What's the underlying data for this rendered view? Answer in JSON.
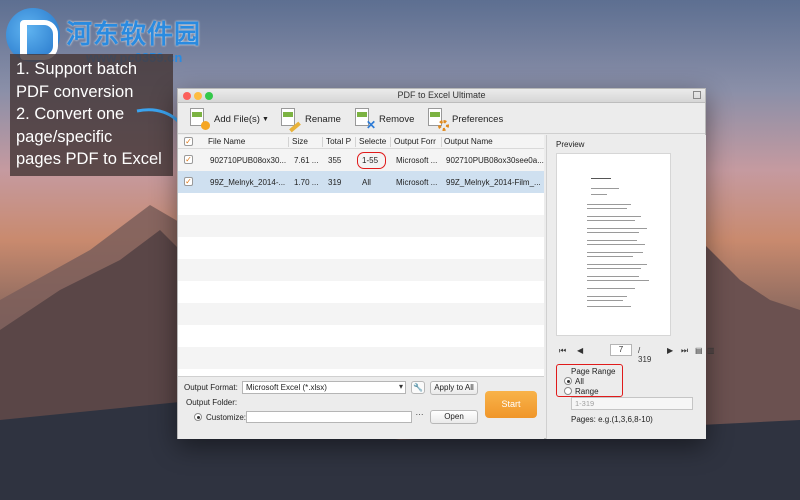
{
  "watermark": {
    "title": "河东软件园",
    "url": "www.pc0359.cn"
  },
  "annotation": {
    "lines": [
      "1. Support batch",
      "PDF conversion",
      "2. Convert one",
      "page/specific",
      "pages PDF to Excel"
    ]
  },
  "window": {
    "title": "PDF to Excel Ultimate",
    "toolbar": {
      "add_files": "Add File(s)",
      "rename": "Rename",
      "remove": "Remove",
      "preferences": "Preferences"
    },
    "columns": [
      "File Name",
      "Size",
      "Total P",
      "Selecte",
      "Output Forr",
      "Output Name"
    ],
    "rows": [
      {
        "name": "902710PUB08ox30...",
        "size": "7.61 ...",
        "total": "355",
        "selected": "1-55",
        "format": "Microsoft ...",
        "output": "902710PUB08ox30see0a..."
      },
      {
        "name": "99Z_Melnyk_2014-...",
        "size": "1.70 ...",
        "total": "319",
        "selected": "All",
        "format": "Microsoft ...",
        "output": "99Z_Melnyk_2014-Film_..."
      }
    ],
    "bottom": {
      "output_format_label": "Output Format:",
      "output_format_value": "Microsoft Excel (*.xlsx)",
      "apply_all": "Apply to All",
      "output_folder_label": "Output Folder:",
      "customize_label": "Customize:",
      "open": "Open",
      "start": "Start"
    },
    "preview": {
      "label": "Preview",
      "current_page": "7",
      "total_pages": "/ 319",
      "page_range_title": "Page Range",
      "all": "All",
      "range": "Range",
      "range_placeholder": "1-319",
      "pages_hint": "Pages: e.g.(1,3,6,8-10)"
    }
  },
  "colors": {
    "accent_orange": "#f0962a",
    "highlight_red": "#e01b1b",
    "selection_blue": "#cfe0f0"
  }
}
